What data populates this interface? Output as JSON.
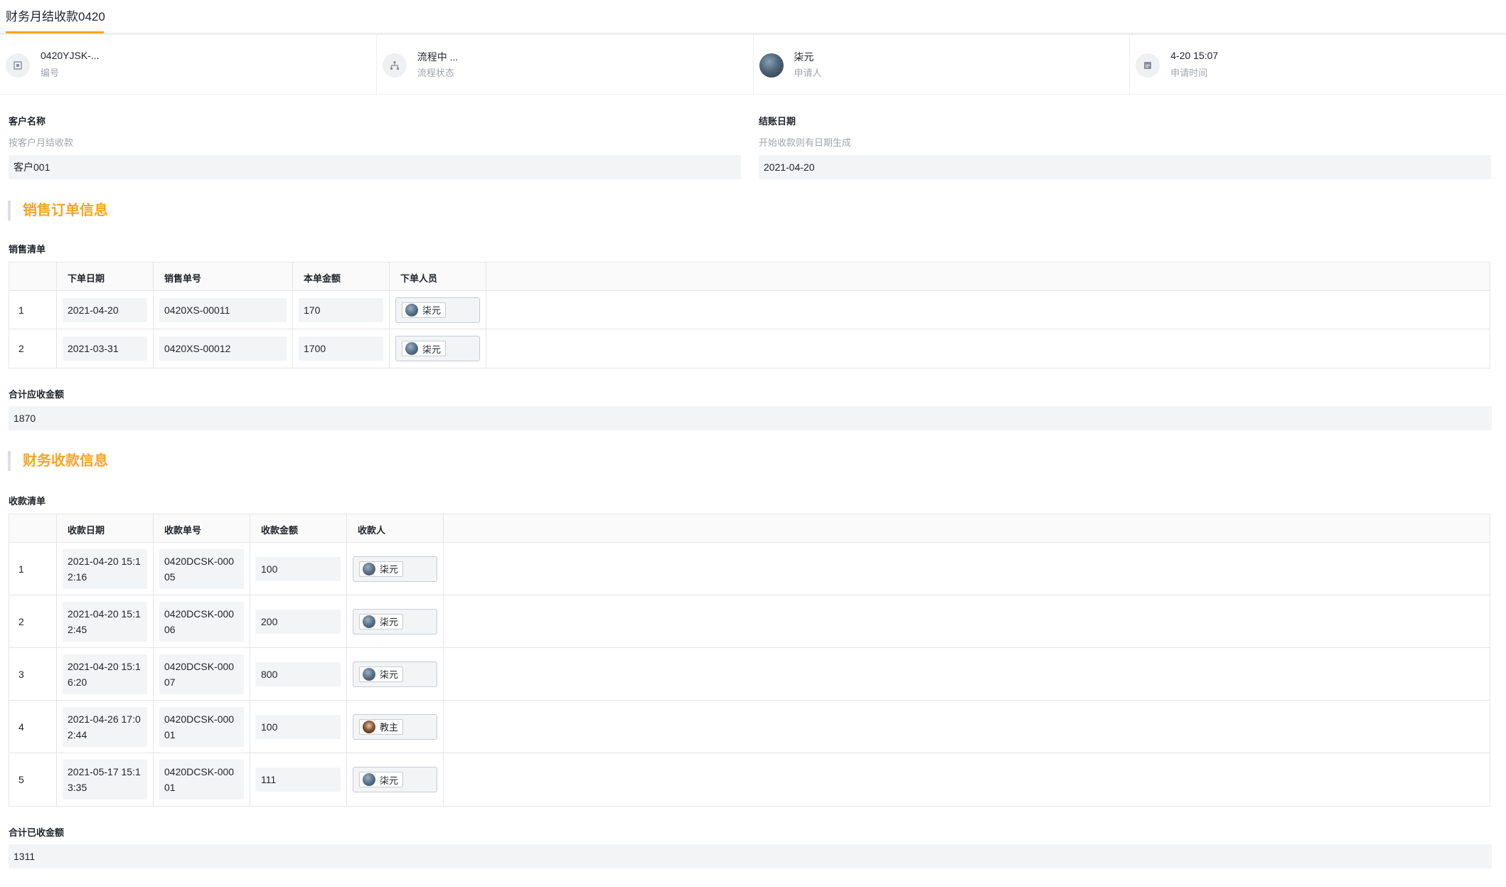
{
  "tab": {
    "title": "财务月结收款0420"
  },
  "info": {
    "number": {
      "value": "0420YJSK-...",
      "label": "编号",
      "icon": "document-icon"
    },
    "status": {
      "value": "流程中 ...",
      "label": "流程状态",
      "icon": "flow-icon"
    },
    "applicant": {
      "value": "柒元",
      "label": "申请人",
      "icon": "avatar"
    },
    "time": {
      "value": "4-20 15:07",
      "label": "申请时间",
      "icon": "calendar-icon"
    }
  },
  "customer": {
    "label": "客户名称",
    "hint": "按客户月结收款",
    "value": "客户001"
  },
  "settle_date": {
    "label": "结账日期",
    "hint": "开始收款则有日期生成",
    "value": "2021-04-20"
  },
  "sales_section": {
    "title": "销售订单信息"
  },
  "sales_list": {
    "label": "销售清单",
    "columns": [
      "下单日期",
      "销售单号",
      "本单金额",
      "下单人员"
    ],
    "rows": [
      {
        "idx": "1",
        "date": "2021-04-20",
        "no": "0420XS-00011",
        "amount": "170",
        "person": "柒元"
      },
      {
        "idx": "2",
        "date": "2021-03-31",
        "no": "0420XS-00012",
        "amount": "1700",
        "person": "柒元"
      }
    ]
  },
  "total_receivable": {
    "label": "合计应收金额",
    "value": "1870"
  },
  "finance_section": {
    "title": "财务收款信息"
  },
  "receipt_list": {
    "label": "收款清单",
    "columns": [
      "收款日期",
      "收款单号",
      "收款金额",
      "收款人"
    ],
    "rows": [
      {
        "idx": "1",
        "date": "2021-04-20 15:12:16",
        "no": "0420DCSK-00005",
        "amount": "100",
        "person": "柒元"
      },
      {
        "idx": "2",
        "date": "2021-04-20 15:12:45",
        "no": "0420DCSK-00006",
        "amount": "200",
        "person": "柒元"
      },
      {
        "idx": "3",
        "date": "2021-04-20 15:16:20",
        "no": "0420DCSK-00007",
        "amount": "800",
        "person": "柒元"
      },
      {
        "idx": "4",
        "date": "2021-04-26 17:02:44",
        "no": "0420DCSK-00001",
        "amount": "100",
        "person": "教主"
      },
      {
        "idx": "5",
        "date": "2021-05-17 15:13:35",
        "no": "0420DCSK-00001",
        "amount": "111",
        "person": "柒元"
      }
    ]
  },
  "total_received": {
    "label": "合计已收金额",
    "value": "1311"
  }
}
